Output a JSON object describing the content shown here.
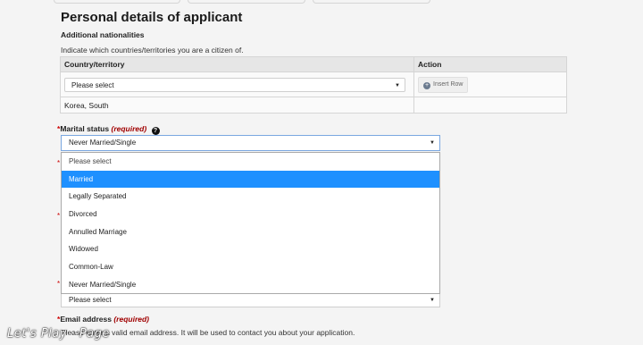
{
  "header": {
    "title": "Personal details of applicant",
    "subtitle": "Additional nationalities",
    "description": "Indicate which countries/territories you are a citizen of."
  },
  "nationality_table": {
    "columns": [
      "Country/territory",
      "Action"
    ],
    "select_placeholder": "Please select",
    "insert_row_label": "Insert Row",
    "rows": [
      "Korea, South"
    ]
  },
  "marital": {
    "label": "Marital status",
    "required": "(required)",
    "selected": "Never Married/Single",
    "options": [
      "Please select",
      "Married",
      "Legally Separated",
      "Divorced",
      "Annulled Marriage",
      "Widowed",
      "Common-Law",
      "Never Married/Single"
    ],
    "highlighted": "Married"
  },
  "hidden_field": {
    "placeholder": "Please select"
  },
  "email": {
    "label": "Email address",
    "required": "(required)",
    "description": "Please enter a valid email address. It will be used to contact you about your application."
  },
  "watermark": "Let's Play · Page",
  "colors": {
    "highlight": "#1e90ff",
    "required": "#a00000",
    "focus_border": "#7aa7e0"
  },
  "icons": {
    "help": "question-circle-icon",
    "insert": "plus-circle-icon",
    "dropdown_arrow": "caret-down-icon"
  }
}
